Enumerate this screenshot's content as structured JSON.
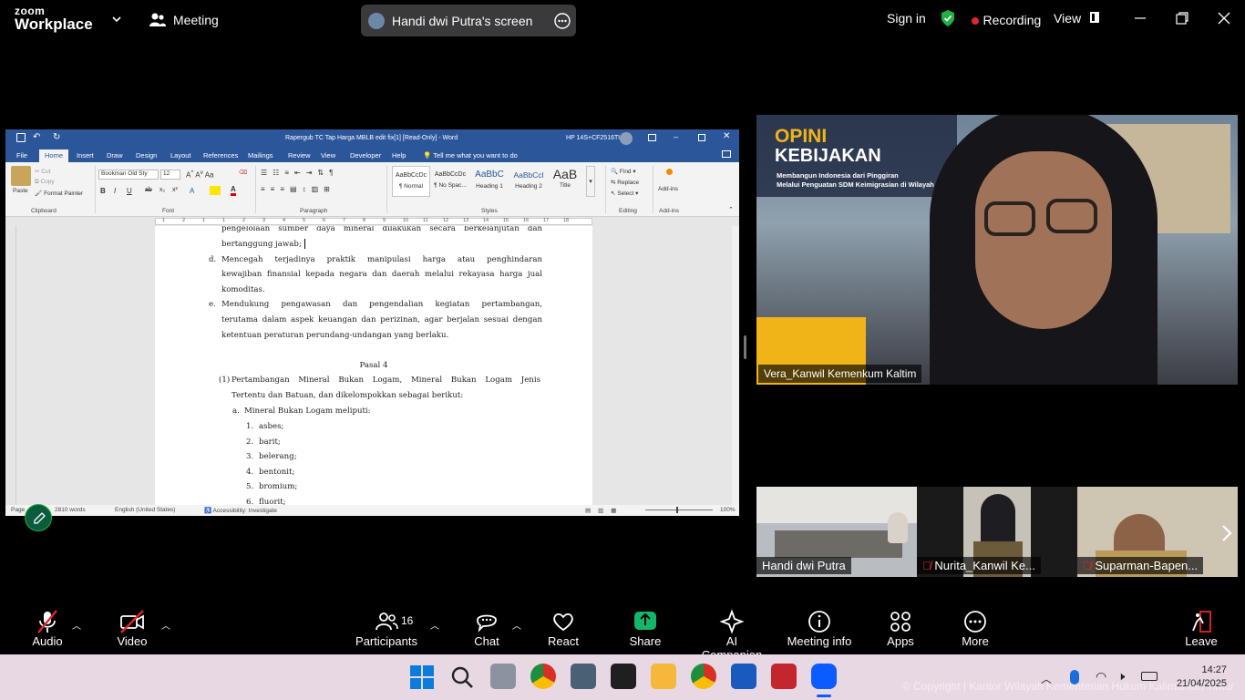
{
  "zoom": {
    "logo_top": "zoom",
    "logo_bottom": "Workplace",
    "meeting_label": "Meeting",
    "share_title": "Handi dwi Putra's screen",
    "sign_in": "Sign in",
    "recording": "Recording",
    "view": "View"
  },
  "word": {
    "title": "Rapergub TC Tap Harga MBLB edit fix[1] [Read-Only] - Word",
    "user": "HP 14S+CF2516TU",
    "tabs": [
      "File",
      "Home",
      "Insert",
      "Draw",
      "Design",
      "Layout",
      "References",
      "Mailings",
      "Review",
      "View",
      "Developer",
      "Help"
    ],
    "tell_me": "Tell me what you want to do",
    "clipboard": {
      "paste": "Paste",
      "cut": "Cut",
      "copy": "Copy",
      "format_painter": "Format Painter",
      "label": "Clipboard"
    },
    "font": {
      "name": "Bookman Old Sty",
      "size": "12",
      "label": "Font"
    },
    "paragraph_label": "Paragraph",
    "styles": [
      {
        "preview": "AaBbCcDc",
        "name": "¶ Normal"
      },
      {
        "preview": "AaBbCcDc",
        "name": "¶ No Spac..."
      },
      {
        "preview": "AaBbC",
        "name": "Heading 1"
      },
      {
        "preview": "AaBbCcl",
        "name": "Heading 2"
      },
      {
        "preview": "AaB",
        "name": "Title"
      }
    ],
    "styles_label": "Styles",
    "editing": {
      "find": "Find",
      "replace": "Replace",
      "select": "Select",
      "label": "Editing"
    },
    "addins": {
      "button": "Add-ins",
      "label": "Add-ins"
    },
    "ruler_numbers": [
      "1",
      "2",
      "1",
      "1",
      "2",
      "3",
      "4",
      "5",
      "6",
      "7",
      "8",
      "9",
      "10",
      "11",
      "12",
      "13",
      "14",
      "15",
      "16",
      "17",
      "18"
    ],
    "document": {
      "lines": [
        "pengelolaan sumber daya mineral dilakukan secara berkelanjutan dan",
        "bertanggung jawab;",
        "d.",
        "Mencegah terjadinya praktik manipulasi harga atau penghindaran",
        "kewajiban finansial kepada negara dan daerah melalui rekayasa harga jual",
        "komoditas.",
        "e.",
        "Mendukung pengawasan dan pengendalian kegiatan pertambangan,",
        "terutama dalam aspek keuangan dan perizinan, agar berjalan sesuai dengan",
        "ketentuan peraturan perundang-undangan yang berlaku.",
        "Pasal 4",
        "(1)",
        "Pertambangan Mineral Bukan Logam, Mineral Bukan Logam Jenis",
        "Tertentu dan Batuan, dan dikelompokkan sebagai berikut:",
        "a.",
        "Mineral Bukan Logam meliputi:"
      ],
      "list": [
        {
          "num": "1.",
          "text": "asbes;"
        },
        {
          "num": "2.",
          "text": "barit;"
        },
        {
          "num": "3.",
          "text": "belerang;"
        },
        {
          "num": "4.",
          "text": "bentonit;"
        },
        {
          "num": "5.",
          "text": "bromium;"
        },
        {
          "num": "6.",
          "text": "fluorit;"
        }
      ]
    },
    "status": {
      "page": "Page",
      "words": "2810 words",
      "language": "English (United States)",
      "accessibility": "Accessibility: Investigate",
      "zoom": "100%"
    }
  },
  "video": {
    "banner_line1": "OPINI",
    "banner_line2": "KEBIJAKAN",
    "banner_line3": "Membangun Indonesia dari Pinggiran",
    "banner_line4": "Melalui Penguatan SDM Keimigrasian di Wilayah Per",
    "main_name": "Vera_Kanwil Kemenkum Kaltim",
    "thumbs": [
      {
        "name": "Handi dwi Putra",
        "muted": false
      },
      {
        "name": "Nurita_Kanwil Ke...",
        "muted": true
      },
      {
        "name": "Suparman-Bapen...",
        "muted": true
      }
    ]
  },
  "toolbar": {
    "audio": "Audio",
    "video": "Video",
    "participants": "Participants",
    "participants_count": "16",
    "chat": "Chat",
    "react": "React",
    "share": "Share",
    "ai": "AI Companion",
    "info": "Meeting info",
    "apps": "Apps",
    "more": "More",
    "leave": "Leave"
  },
  "taskbar": {
    "watermark": "© Copyright | Kantor Wilayah Kementerian Hukum Kalimantan Timur",
    "time": "14:27",
    "date": "21/04/2025"
  },
  "colors": {
    "word_blue": "#2b579a",
    "recording_red": "#e02828",
    "shield_green": "#1fb141",
    "share_green": "#12b76a"
  }
}
